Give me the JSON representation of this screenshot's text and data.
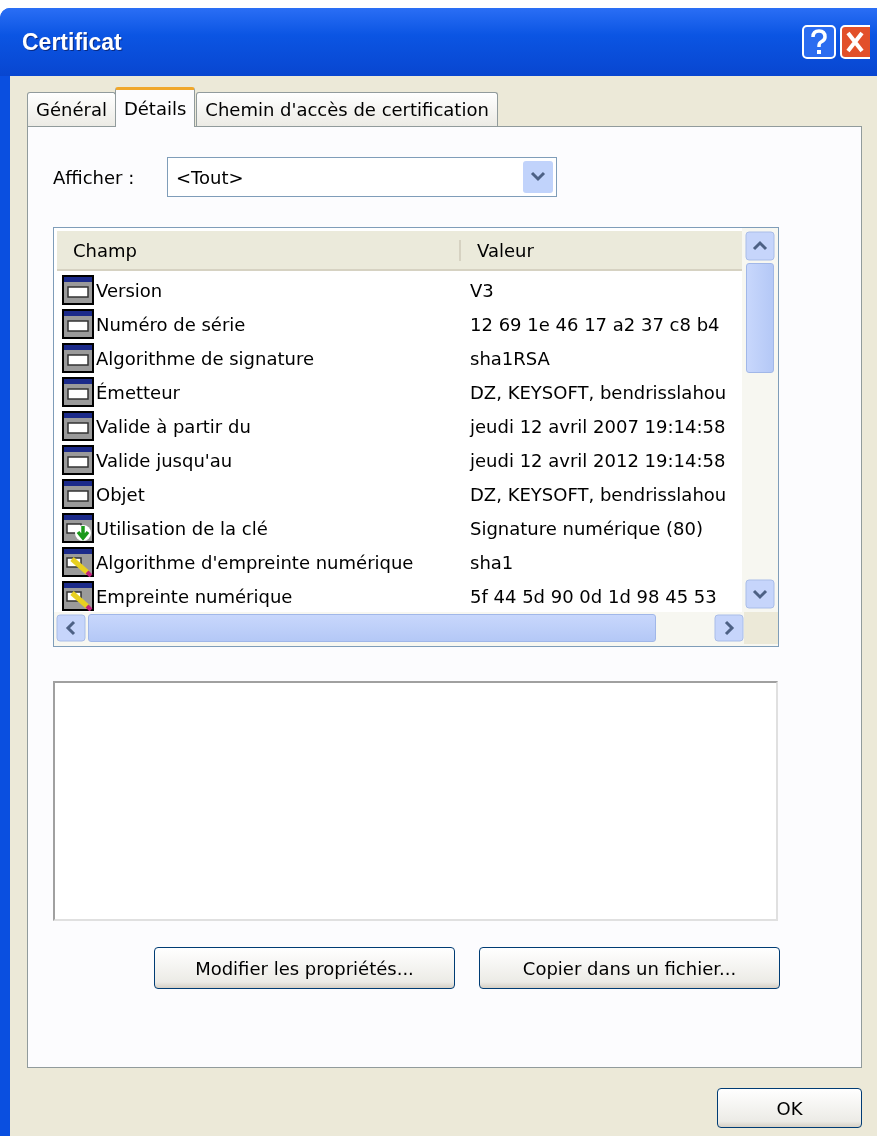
{
  "window": {
    "title": "Certificat"
  },
  "tabs": [
    {
      "label": "Général",
      "selected": false
    },
    {
      "label": "Détails",
      "selected": true
    },
    {
      "label": "Chemin d'accès de certification",
      "selected": false
    }
  ],
  "show": {
    "label": "Afficher :",
    "value": "<Tout>"
  },
  "table": {
    "columns": [
      "Champ",
      "Valeur"
    ],
    "rows": [
      {
        "kind": "field",
        "field": "Version",
        "value": "V3"
      },
      {
        "kind": "field",
        "field": "Numéro de série",
        "value": "12 69 1e 46 17 a2 37 c8 b4"
      },
      {
        "kind": "field",
        "field": "Algorithme de signature",
        "value": "sha1RSA"
      },
      {
        "kind": "field",
        "field": "Émetteur",
        "value": "DZ, KEYSOFT, bendrisslahou"
      },
      {
        "kind": "field",
        "field": "Valide à partir du",
        "value": "jeudi 12 avril 2007 19:14:58"
      },
      {
        "kind": "field",
        "field": "Valide jusqu'au",
        "value": "jeudi 12 avril 2012 19:14:58"
      },
      {
        "kind": "field",
        "field": "Objet",
        "value": "DZ, KEYSOFT, bendrisslahou"
      },
      {
        "kind": "extension",
        "field": "Utilisation de la clé",
        "value": "Signature numérique (80)"
      },
      {
        "kind": "property",
        "field": "Algorithme d'empreinte numérique",
        "value": "sha1"
      },
      {
        "kind": "property",
        "field": "Empreinte numérique",
        "value": "5f 44 5d 90 0d 1d 98 45 53"
      }
    ]
  },
  "buttons": [
    "Modifier les propriétés...",
    "Copier dans un fichier..."
  ],
  "ok_button": "OK"
}
